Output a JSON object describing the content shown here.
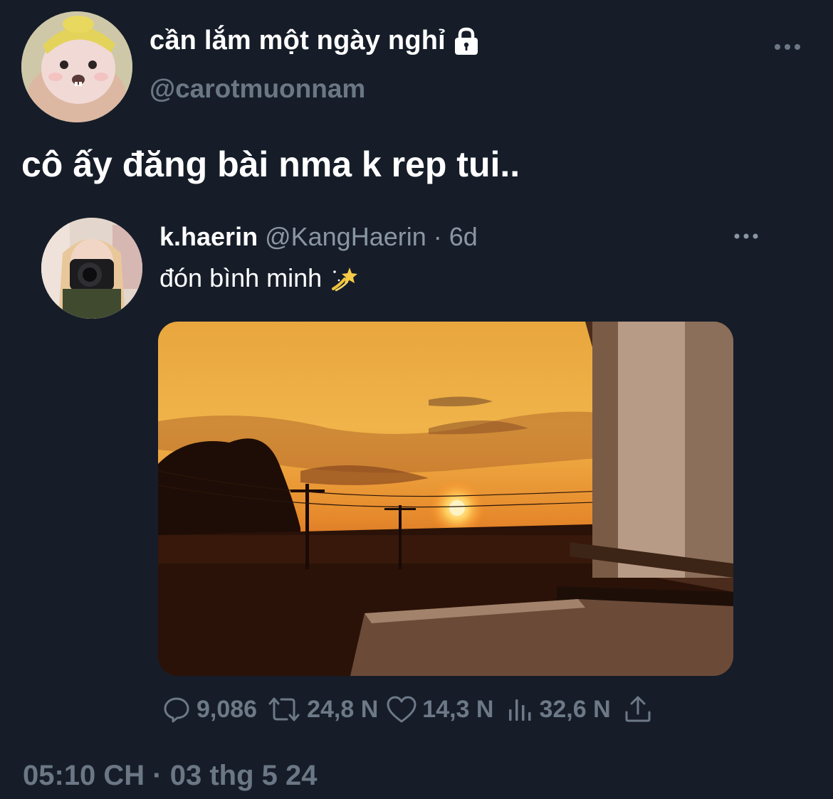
{
  "tweet": {
    "display_name": "cần lắm một ngày nghỉ",
    "handle": "@carotmuonnam",
    "text": "cô ấy đăng bài nma k rep tui..",
    "timestamp": "05:10 CH · 03 thg 5 24",
    "protected_icon": "lock-icon",
    "more_icon": "more-dots-icon"
  },
  "quoted": {
    "display_name": "k.haerin",
    "handle": "@KangHaerin",
    "separator": "·",
    "time": "6d",
    "text": "đón bình minh",
    "emoji_icon": "dizzy-star-icon",
    "media_description_icon": "sunset-photo"
  },
  "actions": {
    "reply_count": "9,086",
    "retweet_count": "24,8 N",
    "like_count": "14,3 N",
    "views_count": "32,6 N"
  },
  "colors": {
    "background": "#161d29",
    "primary_text": "#ffffff",
    "secondary_text": "#6b7785"
  }
}
